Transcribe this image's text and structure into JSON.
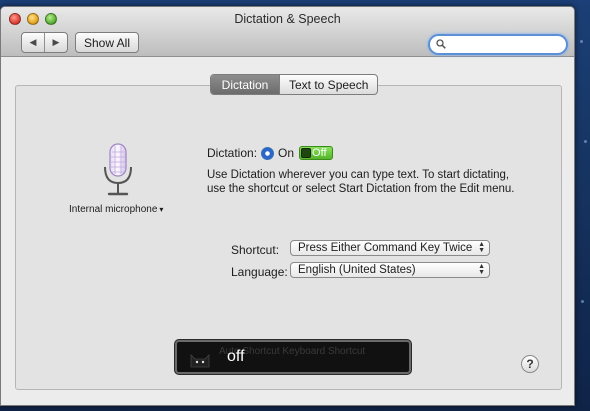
{
  "window": {
    "title": "Dictation & Speech"
  },
  "toolbar": {
    "back_glyph": "◀",
    "forward_glyph": "▶",
    "show_all_label": "Show All",
    "search_value": "",
    "search_icon": "search-icon"
  },
  "tabs": [
    {
      "label": "Dictation",
      "active": true
    },
    {
      "label": "Text to Speech",
      "active": false
    }
  ],
  "microphone": {
    "icon": "microphone-icon",
    "source_label": "Internal microphone",
    "dropdown_glyph": "▾"
  },
  "dictation": {
    "label": "Dictation:",
    "on_label": "On",
    "on_selected": true,
    "toggle_label": "Off",
    "description": "Use Dictation wherever you can type text. To start dictating, use the shortcut or select Start Dictation from the Edit menu."
  },
  "shortcut": {
    "label": "Shortcut:",
    "value": "Press Either Command Key Twice"
  },
  "language": {
    "label": "Language:",
    "value": "English (United States)"
  },
  "hud": {
    "icon": "cat-icon",
    "background_text": "Auto Shortcut Keyboard Shortcut",
    "state": "off"
  },
  "help": {
    "glyph": "?"
  },
  "colors": {
    "desktop": "#16335f",
    "search_focus": "#5b8fd6",
    "radio_selected": "#2b67c8",
    "toggle_green": "#56b52b",
    "hud_background": "#111111"
  }
}
